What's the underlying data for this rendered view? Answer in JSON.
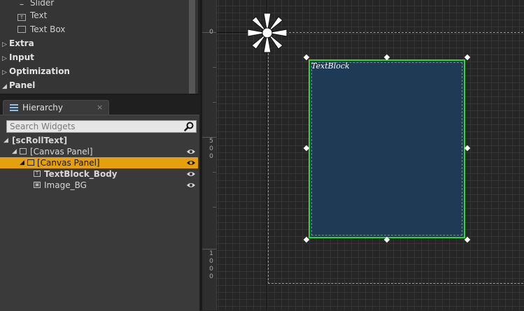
{
  "palette": {
    "items": [
      {
        "label": "Slider",
        "icon": "slider-icon"
      },
      {
        "label": "Text",
        "icon": "text-icon"
      },
      {
        "label": "Text Box",
        "icon": "textbox-icon"
      }
    ],
    "categories": [
      {
        "label": "Extra",
        "expanded": false
      },
      {
        "label": "Input",
        "expanded": false
      },
      {
        "label": "Optimization",
        "expanded": false
      },
      {
        "label": "Panel",
        "expanded": true
      }
    ]
  },
  "hierarchy": {
    "tab_label": "Hierarchy",
    "tab_close": "×",
    "search": {
      "placeholder": "Search Widgets",
      "value": ""
    },
    "rows": [
      {
        "label": "[scRollText]",
        "bold": true,
        "selected": false
      },
      {
        "label": "[Canvas Panel]",
        "bold": false,
        "selected": false
      },
      {
        "label": "[Canvas Panel]",
        "bold": false,
        "selected": true
      },
      {
        "label": "TextBlock_Body",
        "bold": true,
        "selected": false
      },
      {
        "label": "Image_BG",
        "bold": false,
        "selected": false
      }
    ]
  },
  "designer": {
    "ruler_labels": {
      "zero": "0",
      "fifty": [
        "5",
        "0",
        "0"
      ],
      "hundred": [
        "1",
        "0",
        "0",
        "0"
      ]
    },
    "text_block_label": "TextBlock"
  },
  "colors": {
    "selection": "#e5a10b",
    "widget_outline": "#34d234",
    "widget_fill": "#1e3a55",
    "accent_icon": "#8fbfe8"
  }
}
